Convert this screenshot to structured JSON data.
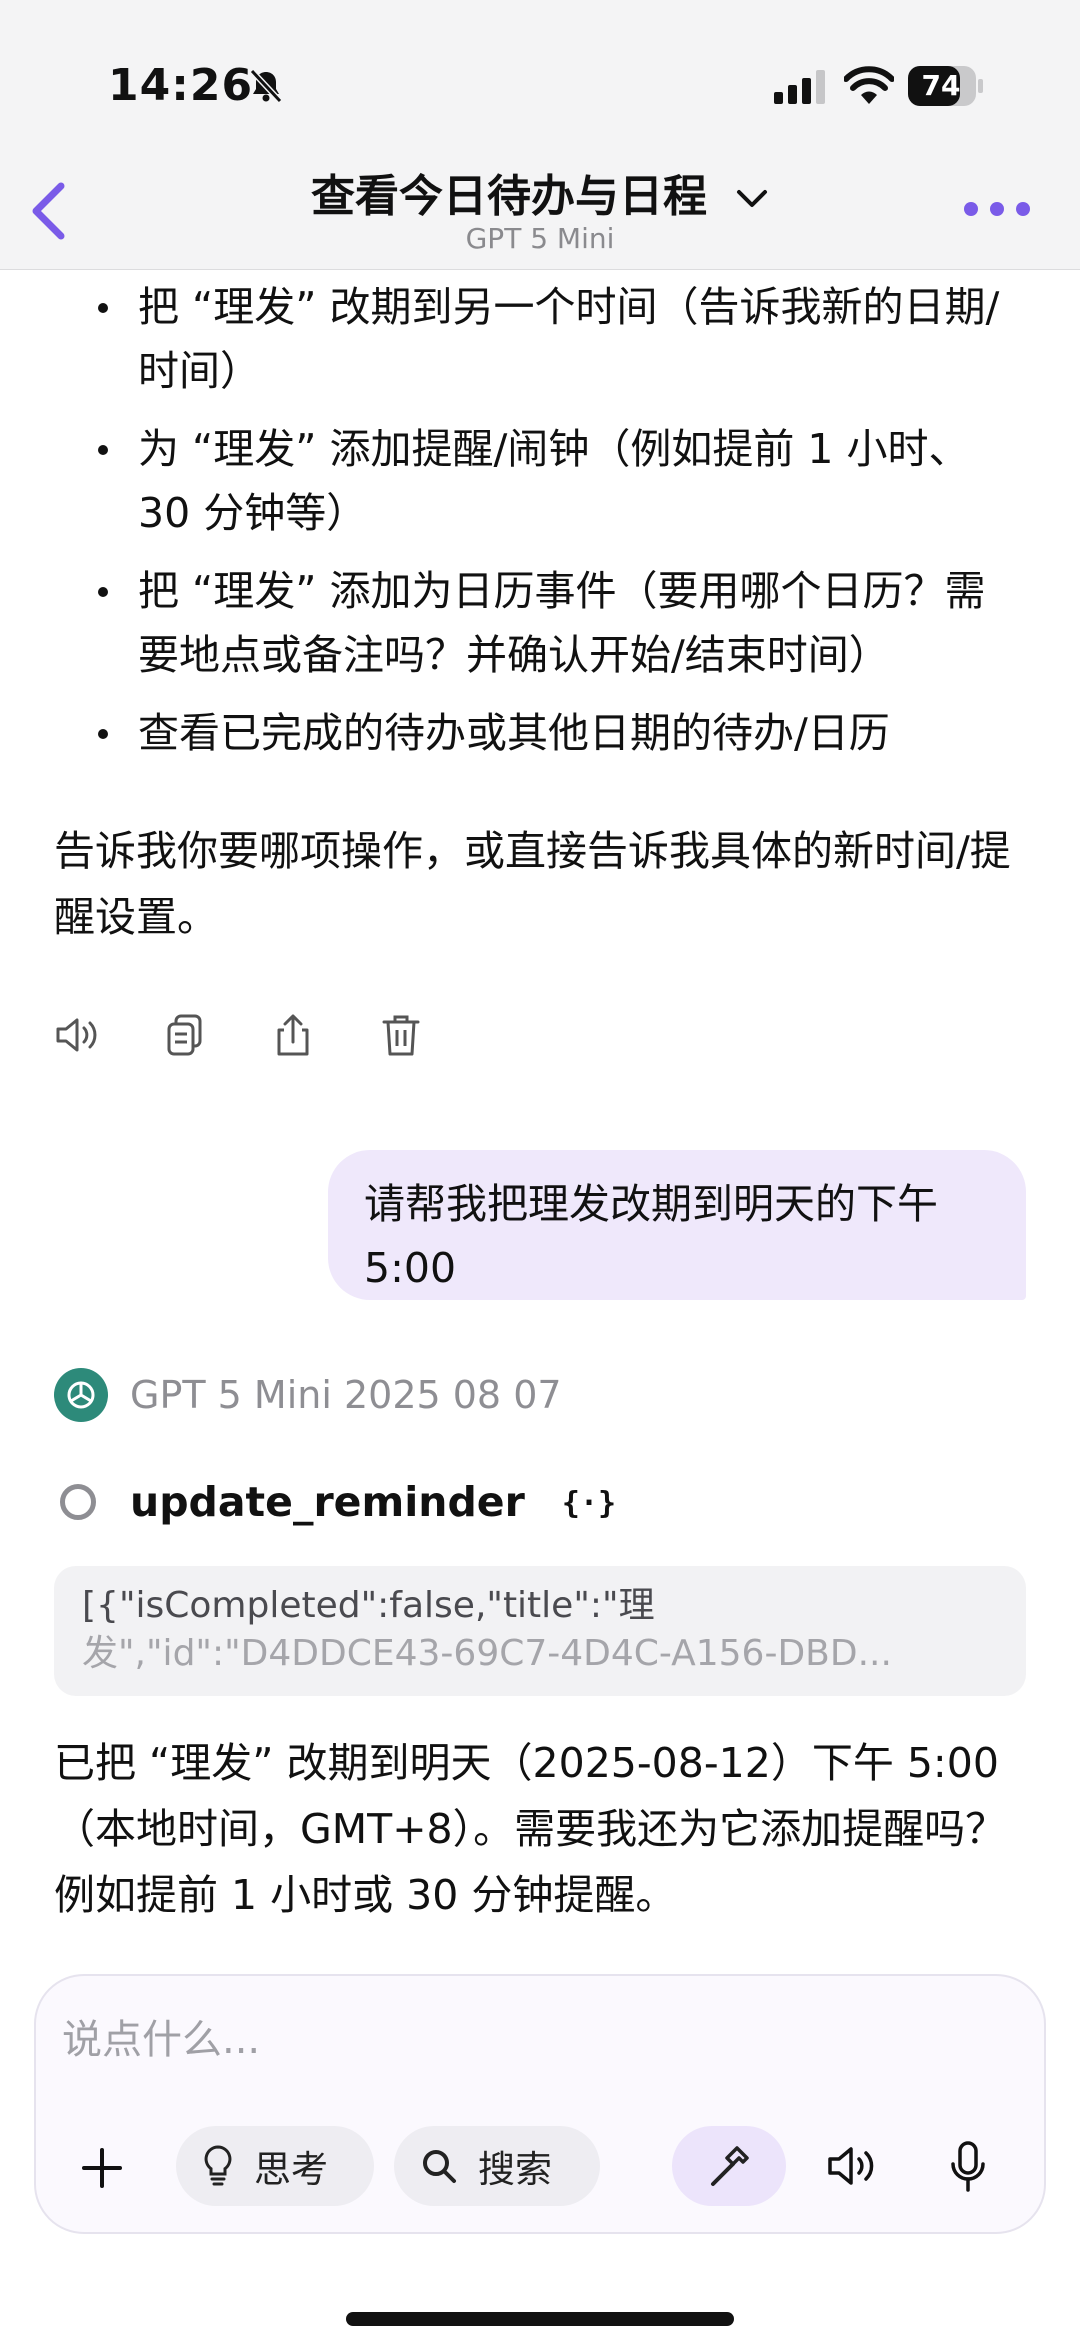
{
  "status_bar": {
    "time": "14:26",
    "battery": "74"
  },
  "nav": {
    "title": "查看今日待办与日程",
    "subtitle": "GPT 5 Mini"
  },
  "assistant_prev": {
    "bullets": [
      "把 “理发” 改期到另一个时间（告诉我新的日期/时间）",
      "为 “理发” 添加提醒/闹钟（例如提前 1 小时、30 分钟等）",
      "把 “理发” 添加为日历事件（要用哪个日历？需要地点或备注吗？并确认开始/结束时间）",
      "查看已完成的待办或其他日期的待办/日历"
    ],
    "closing": "告诉我你要哪项操作，或直接告诉我具体的新时间/提醒设置。"
  },
  "user_message": "请帮我把理发改期到明天的下午 5:00",
  "assistant_reply": {
    "model_label": "GPT 5 Mini 2025 08 07",
    "tool_name": "update_reminder",
    "tool_output_line1": "[{\"isCompleted\":false,\"title\":\"理",
    "tool_output_line2": "发\",\"id\":\"D4DDCE43-69C7-4D4C-A156-DBD...",
    "text": "已把 “理发” 改期到明天（2025-08-12）下午 5:00（本地时间，GMT+8）。需要我还为它添加提醒吗？例如提前 1 小时或 30 分钟提醒。"
  },
  "composer": {
    "placeholder": "说点什么...",
    "think_label": "思考",
    "search_label": "搜索"
  },
  "icons": {
    "accent": "#7a5be8",
    "hammer_bg": "#ece4fb",
    "user_bubble_bg": "#efe8fb"
  }
}
